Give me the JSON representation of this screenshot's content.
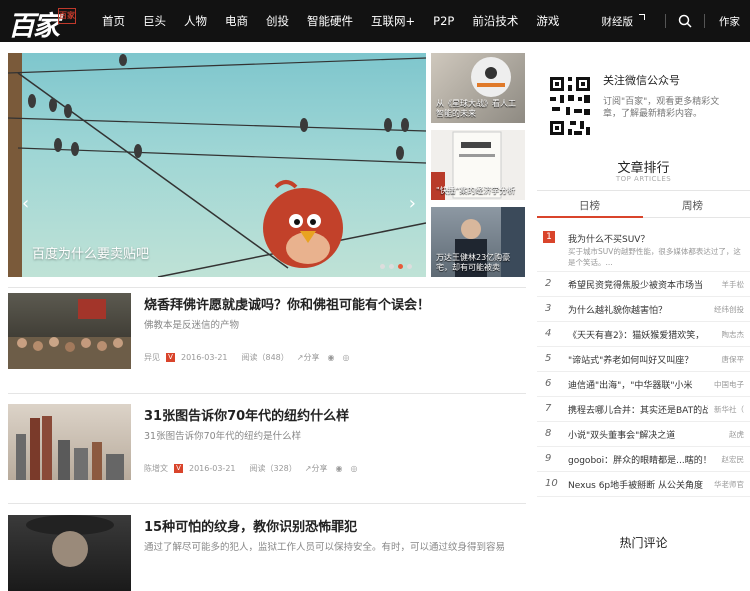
{
  "logo": {
    "text": "百家",
    "stamp": "百家"
  },
  "nav": {
    "items": [
      "首页",
      "巨头",
      "人物",
      "电商",
      "创投",
      "智能硬件",
      "互联网+",
      "P2P",
      "前沿技术",
      "游戏"
    ],
    "finance": "财经版",
    "author": "作家"
  },
  "carousel": {
    "caption": "百度为什么要卖贴吧",
    "prev": "‹",
    "next": "›"
  },
  "side_thumbs": [
    {
      "caption": "从《星球大战》看人工智能的未来"
    },
    {
      "caption": "\"快播\"案的经济学分析"
    },
    {
      "caption": "万达王健林23亿购豪宅，却有可能被卖"
    }
  ],
  "articles": [
    {
      "title": "烧香拜佛许愿就虔诚吗？你和佛祖可能有个误会！",
      "summary": "佛教本是反迷信的产物",
      "author": "异见",
      "badge": "V",
      "date": "2016-03-21",
      "views": "阅读（848）",
      "share": "分享"
    },
    {
      "title": "31张图告诉你70年代的纽约什么样",
      "summary": "31张图告诉你70年代的纽约是什么样",
      "author": "陈增文",
      "badge": "V",
      "date": "2016-03-21",
      "views": "阅读（328）",
      "share": "分享"
    },
    {
      "title": "15种可怕的纹身，教你识别恐怖罪犯",
      "summary": "通过了解尽可能多的犯人，监狱工作人员可以保持安全。有时，可以通过纹身得到容易"
    }
  ],
  "right": {
    "wx_title": "关注微信公众号",
    "wx_desc": "订阅\"百家\"，观看更多精彩文章，了解最新精彩内容。",
    "rank_title": "文章排行",
    "rank_sub": "TOP ARTICLES",
    "tab_day": "日榜",
    "tab_week": "周榜",
    "rank_first": {
      "num": "1",
      "title": "我为什么不买SUV？",
      "detail": "买于城市SUV的越野性能，很多媒体都表达过了，这是个笑话。..."
    },
    "ranks": [
      {
        "num": "2",
        "title": "希望民资竞得焦股少被资本市场当",
        "author": "羊手松"
      },
      {
        "num": "3",
        "title": "为什么越礼貌你越害怕？",
        "author": "经纬创投"
      },
      {
        "num": "4",
        "title": "《天天有喜2》：猫妖猴爱猎欢笑，",
        "author": "陶志杰"
      },
      {
        "num": "5",
        "title": "\"谛站式\"养老如何叫好又叫座？",
        "author": "唐保平"
      },
      {
        "num": "6",
        "title": "迪信通\"出海\"，\"中华器联\"小米",
        "author": "中国电子"
      },
      {
        "num": "7",
        "title": "携程去哪儿合并：其实还是BAT的战",
        "author": "新华社（"
      },
      {
        "num": "8",
        "title": "小说\"双头董事会\"解决之道",
        "author": "赵虎"
      },
      {
        "num": "9",
        "title": "gogoboi：胖众的眼睛都是...瞎的！",
        "author": "赵宏民"
      },
      {
        "num": "10",
        "title": "Nexus 6p地手被掰断 从公关角度",
        "author": "华老师官"
      }
    ],
    "hot_title": "热门评论"
  },
  "colors": {
    "accent": "#d9442b",
    "topbar": "#121212"
  }
}
